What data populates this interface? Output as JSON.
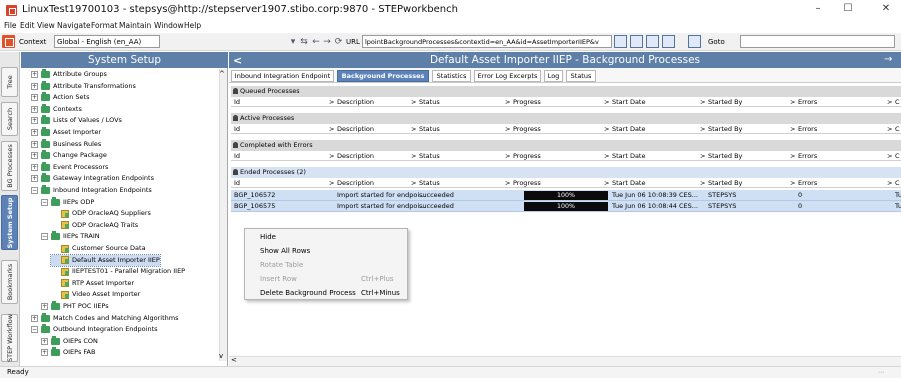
{
  "window": {
    "title": "LinuxTest19700103 - stepsys@http://stepserver1907.stibo.corp:9870 - STEPworkbench",
    "minimize": "–",
    "maximize": "☐",
    "close": "✕"
  },
  "menu": [
    "File",
    "Edit",
    "View",
    "Navigate",
    "Format",
    "Maintain",
    "Window",
    "Help"
  ],
  "toolbar": {
    "context_label": "Context",
    "context_value": "Global - English (en_AA)",
    "url_label": "URL",
    "url_value": "lpointBackgroundProcesses&contextid=en_AA&id=AssetImporterIIEP&v",
    "goto_label": "Goto",
    "goto_value": ""
  },
  "left_tabs": [
    {
      "label": "Tree",
      "active": false
    },
    {
      "label": "Search",
      "active": false
    },
    {
      "label": "BG Processes",
      "active": false
    },
    {
      "label": "System Setup",
      "active": true
    },
    {
      "label": "Bookmarks",
      "active": false
    },
    {
      "label": "STEP Workflow",
      "active": false
    }
  ],
  "sidebar": {
    "title": "System Setup",
    "tree": [
      {
        "label": "Attribute Groups",
        "exp": "+",
        "icon": "folder",
        "level": 0
      },
      {
        "label": "Attribute Transformations",
        "exp": "+",
        "icon": "folder",
        "level": 0
      },
      {
        "label": "Action Sets",
        "exp": "+",
        "icon": "folder",
        "level": 0
      },
      {
        "label": "Contexts",
        "exp": "+",
        "icon": "folder",
        "level": 0
      },
      {
        "label": "Lists of Values / LOVs",
        "exp": "+",
        "icon": "folder",
        "level": 0
      },
      {
        "label": "Asset Importer",
        "exp": "+",
        "icon": "folder",
        "level": 0
      },
      {
        "label": "Business Rules",
        "exp": "+",
        "icon": "folder",
        "level": 0
      },
      {
        "label": "Change Package",
        "exp": "+",
        "icon": "folder",
        "level": 0
      },
      {
        "label": "Event Processors",
        "exp": "+",
        "icon": "folder",
        "level": 0
      },
      {
        "label": "Gateway Integration Endpoints",
        "exp": "+",
        "icon": "folder",
        "level": 0
      },
      {
        "label": "Inbound Integration Endpoints",
        "exp": "−",
        "icon": "folder",
        "level": 0
      },
      {
        "label": "IIEPs ODP",
        "exp": "−",
        "icon": "folder",
        "level": 1
      },
      {
        "label": "ODP OracleAQ Suppliers",
        "exp": "",
        "icon": "item",
        "level": 2
      },
      {
        "label": "ODP OracleAQ Traits",
        "exp": "",
        "icon": "item",
        "level": 2
      },
      {
        "label": "IIEPs TRAIN",
        "exp": "−",
        "icon": "folder",
        "level": 1
      },
      {
        "label": "Customer Source Data",
        "exp": "",
        "icon": "item",
        "level": 2
      },
      {
        "label": "Default Asset Importer IIEP",
        "exp": "",
        "icon": "item",
        "level": 2,
        "selected": true
      },
      {
        "label": "IIEPTEST01 - Parallel Migration IIEP",
        "exp": "",
        "icon": "item",
        "level": 2
      },
      {
        "label": "RTP Asset Importer",
        "exp": "",
        "icon": "item",
        "level": 2
      },
      {
        "label": "Video Asset Importer",
        "exp": "",
        "icon": "item",
        "level": 2
      },
      {
        "label": "PHT POC IIEPs",
        "exp": "+",
        "icon": "folder",
        "level": 1
      },
      {
        "label": "Match Codes and Matching Algorithms",
        "exp": "+",
        "icon": "folder",
        "level": 0
      },
      {
        "label": "Outbound Integration Endpoints",
        "exp": "−",
        "icon": "folder",
        "level": 0
      },
      {
        "label": "OIEPs CON",
        "exp": "+",
        "icon": "folder",
        "level": 1
      },
      {
        "label": "OIEPs FAB",
        "exp": "+",
        "icon": "folder",
        "level": 1
      }
    ]
  },
  "main": {
    "title": "Default Asset Importer IIEP - Background Processes",
    "tabs": [
      {
        "label": "Inbound Integration Endpoint",
        "active": false
      },
      {
        "label": "Background Processes",
        "active": true
      },
      {
        "label": "Statistics",
        "active": false
      },
      {
        "label": "Error Log Excerpts",
        "active": false
      },
      {
        "label": "Log",
        "active": false
      },
      {
        "label": "Status",
        "active": false
      }
    ],
    "columns": [
      "Id",
      "Description",
      "Status",
      "Progress",
      "Start Date",
      "Started By",
      "Errors",
      "C"
    ],
    "sections": [
      {
        "title": "Queued Processes",
        "rows": []
      },
      {
        "title": "Active Processes",
        "rows": []
      },
      {
        "title": "Completed with Errors",
        "rows": []
      },
      {
        "title": "Ended Processes (2)",
        "rows": [
          {
            "id": "BGP_106572",
            "description": "Import started for endpoi...",
            "status": "succeeded",
            "progress_label": "100%",
            "progress": 1.0,
            "start_date": "Tue Jun 06 10:08:39 CES...",
            "started_by": "STEPSYS",
            "errors": "0",
            "c": "Tu"
          },
          {
            "id": "BGP_106575",
            "description": "Import started for endpoi...",
            "status": "succeeded",
            "progress_label": "100%",
            "progress": 1.0,
            "start_date": "Tue Jun 06 10:08:44 CES...",
            "started_by": "STEPSYS",
            "errors": "0",
            "c": "Tu"
          }
        ]
      }
    ]
  },
  "context_menu": [
    {
      "label": "Hide",
      "shortcut": "",
      "disabled": false
    },
    {
      "label": "Show All Rows",
      "shortcut": "",
      "disabled": false
    },
    {
      "label": "Rotate Table",
      "shortcut": "",
      "disabled": true
    },
    {
      "label": "Insert Row",
      "shortcut": "Ctrl+Plus",
      "disabled": true
    },
    {
      "label": "Delete Background Process",
      "shortcut": "Ctrl+Minus",
      "disabled": false
    }
  ],
  "status": {
    "text": "Ready"
  },
  "colors": {
    "header_blue": "#5e7fa8",
    "tab_active": "#5d82b8",
    "row_selected": "#cfe0f5",
    "progress_fill": "#0b0b0b"
  }
}
